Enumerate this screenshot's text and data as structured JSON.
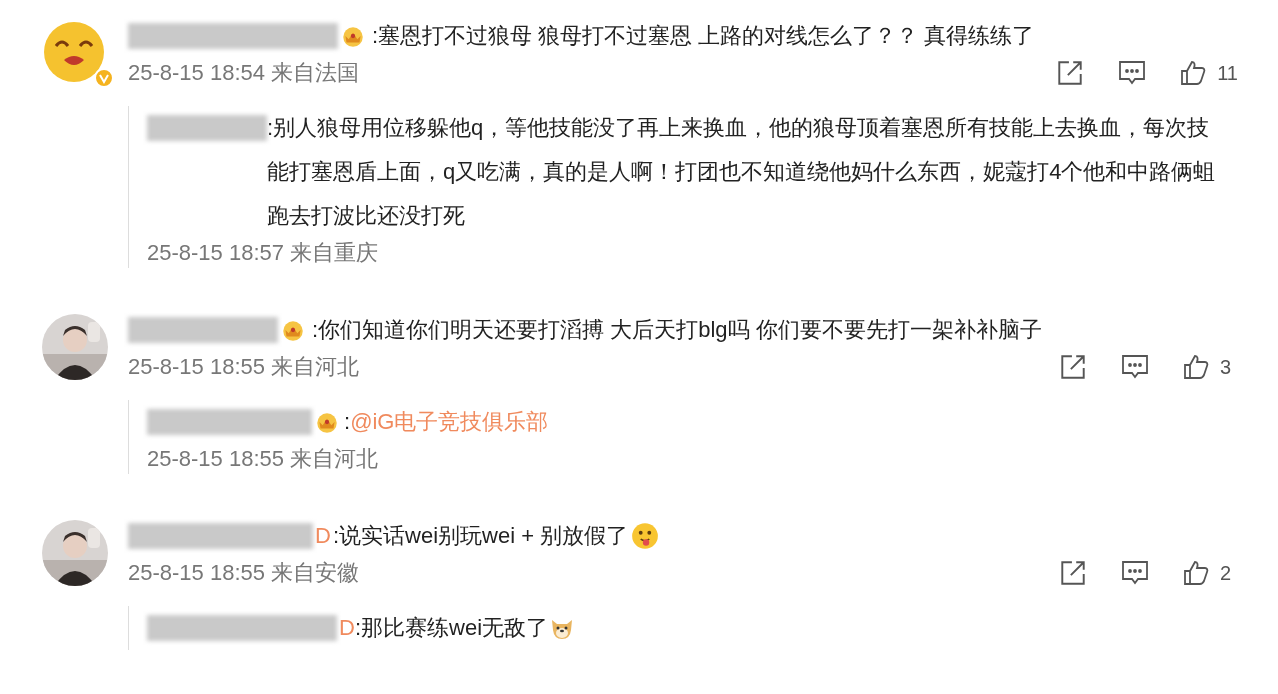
{
  "comments": [
    {
      "avatar": {
        "kind": "smiley"
      },
      "verified": true,
      "badge": true,
      "text": ":塞恩打不过狼母 狼母打不过塞恩 上路的对线怎么了？？ 真得练练了",
      "time": "25-8-15 18:54 来自法国",
      "likes": "11",
      "replies": [
        {
          "badge": false,
          "text": ":别人狼母用位移躲他q，等他技能没了再上来换血，他的狼母顶着塞恩所有技能上去换血，每次技能打塞恩盾上面，q又吃满，真的是人啊！打团也不知道绕他妈什么东西，妮蔻打4个他和中路俩蛆跑去打波比还没打死",
          "time": "25-8-15 18:57 来自重庆"
        }
      ]
    },
    {
      "verified": false,
      "badge": true,
      "text": ":你们知道你们明天还要打滔搏 大后天打blg吗 你们要不要先打一架补补脑子",
      "time": "25-8-15 18:55 来自河北",
      "likes": "3",
      "replies": [
        {
          "badge": true,
          "text": ":",
          "mention": "@iG电子竞技俱乐部",
          "time": "25-8-15 18:55 来自河北"
        }
      ]
    },
    {
      "verified": false,
      "name_fragment": "D",
      "badge": false,
      "text": ":说实话wei别玩wei + 别放假了",
      "emoji": {
        "kind": "tongue"
      },
      "time": "25-8-15 18:55 来自安徽",
      "likes": "2",
      "replies": [
        {
          "name_fragment": "D",
          "badge": false,
          "text": ":那比赛练wei无敌了",
          "emoji": {
            "kind": "dog"
          }
        }
      ]
    }
  ]
}
